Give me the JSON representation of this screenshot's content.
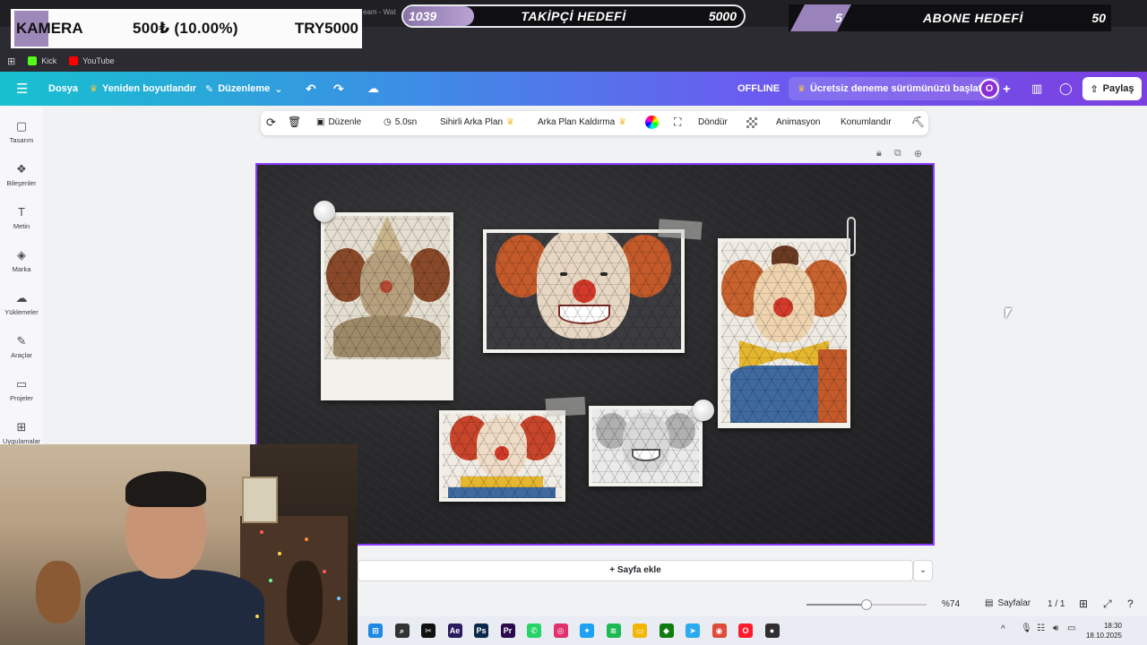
{
  "browser": {
    "tab_title_fragment": "eam - Wat",
    "bookmarks": [
      {
        "label": "Kick",
        "color": "#53fc18"
      },
      {
        "label": "YouTube",
        "color": "#ff0000"
      }
    ]
  },
  "overlays": {
    "kamera": {
      "label": "KAMERA",
      "amount": "500₺ (10.00%)",
      "goal": "TRY5000",
      "progress": 0.1
    },
    "takipci": {
      "current": "1039",
      "title": "TAKİPÇİ HEDEFİ",
      "target": "5000",
      "progress": 0.2078
    },
    "abone": {
      "current": "5",
      "title": "ABONE HEDEFİ",
      "target": "50",
      "progress": 0.1
    }
  },
  "topbar": {
    "file": "Dosya",
    "resize": "Yeniden boyutlandır",
    "edit": "Düzenleme",
    "status": "OFFLINE",
    "trial": "Ücretsiz deneme sürümünüzü başlatın",
    "avatar_letter": "O",
    "share": "Paylaş"
  },
  "sidebar": {
    "items": [
      {
        "label": "Tasarım",
        "icon": "template-icon"
      },
      {
        "label": "Bileşenler",
        "icon": "elements-icon"
      },
      {
        "label": "Metin",
        "icon": "text-icon"
      },
      {
        "label": "Marka",
        "icon": "brand-icon"
      },
      {
        "label": "Yüklemeler",
        "icon": "upload-cloud-icon"
      },
      {
        "label": "Araçlar",
        "icon": "draw-icon"
      },
      {
        "label": "Projeler",
        "icon": "folder-icon"
      },
      {
        "label": "Uygulamalar",
        "icon": "apps-icon"
      }
    ]
  },
  "element_toolbar": {
    "edit": "Düzenle",
    "duration": "5.0sn",
    "magic_bg": "Sihirli Arka Plan",
    "bg_remove": "Arka Plan Kaldırma",
    "rotate": "Döndür",
    "animate": "Animasyon",
    "position": "Konumlandır"
  },
  "bottom": {
    "add_page": "+ Sayfa ekle",
    "zoom": "%74",
    "zoom_fraction": 0.5,
    "pages_label": "Sayfalar",
    "page_count": "1 / 1"
  },
  "taskbar": {
    "time": "18:30",
    "date": "18.10.2025",
    "apps": [
      {
        "name": "windows-start-icon",
        "color": "#1e88e5",
        "glyph": "⊞"
      },
      {
        "name": "search-icon",
        "color": "#333333",
        "glyph": "⌕"
      },
      {
        "name": "capcut-icon",
        "color": "#111111",
        "glyph": "✂"
      },
      {
        "name": "after-effects-icon",
        "color": "#2a1a5e",
        "glyph": "Ae"
      },
      {
        "name": "photoshop-icon",
        "color": "#0b2a4a",
        "glyph": "Ps"
      },
      {
        "name": "premiere-icon",
        "color": "#2a0a4a",
        "glyph": "Pr"
      },
      {
        "name": "whatsapp-icon",
        "color": "#25d366",
        "glyph": "✆"
      },
      {
        "name": "instagram-icon",
        "color": "#e1306c",
        "glyph": "◎"
      },
      {
        "name": "twitter-icon",
        "color": "#1da1f2",
        "glyph": "✦"
      },
      {
        "name": "spotify-icon",
        "color": "#1db954",
        "glyph": "≋"
      },
      {
        "name": "file-explorer-icon",
        "color": "#f2b705",
        "glyph": "▭"
      },
      {
        "name": "xbox-icon",
        "color": "#107c10",
        "glyph": "◆"
      },
      {
        "name": "telegram-icon",
        "color": "#2aabee",
        "glyph": "➤"
      },
      {
        "name": "chrome-icon",
        "color": "#dd4b39",
        "glyph": "◉"
      },
      {
        "name": "opera-icon",
        "color": "#ff1b2d",
        "glyph": "O"
      },
      {
        "name": "obs-icon",
        "color": "#302e31",
        "glyph": "●"
      }
    ]
  },
  "colors": {
    "accent": "#8b3dff",
    "topbar_start": "#17c1cf",
    "topbar_end": "#7b3fe0"
  }
}
